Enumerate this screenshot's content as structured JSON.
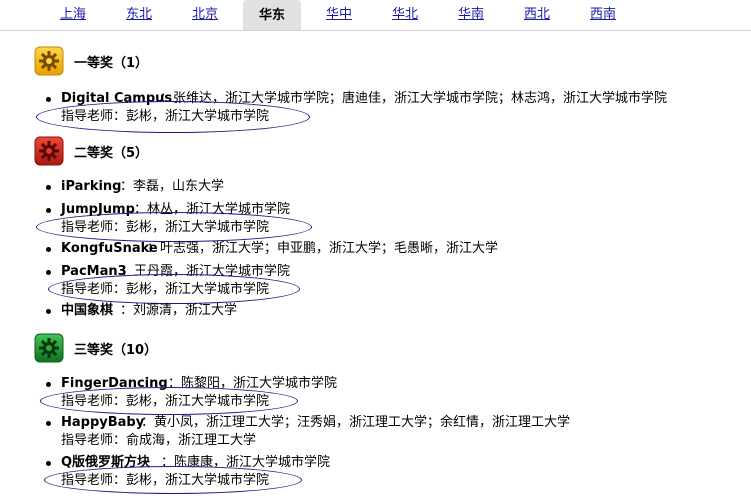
{
  "tabs": [
    {
      "label": "上海",
      "active": false
    },
    {
      "label": "东北",
      "active": false
    },
    {
      "label": "北京",
      "active": false
    },
    {
      "label": "华东",
      "active": true
    },
    {
      "label": "华中",
      "active": false
    },
    {
      "label": "华北",
      "active": false
    },
    {
      "label": "华南",
      "active": false
    },
    {
      "label": "西北",
      "active": false
    },
    {
      "label": "西南",
      "active": false
    }
  ],
  "awards": {
    "first": {
      "title": "一等奖（1）",
      "icon": "gear-icon",
      "color": "#f2b705",
      "entries": [
        {
          "team": "Digital Campus",
          "members": "：张维达，浙江大学城市学院；唐迪佳，浙江大学城市学院；林志鸿，浙江大学城市学院",
          "advisor": "指导老师：彭彬，浙江大学城市学院"
        }
      ]
    },
    "second": {
      "title": "二等奖（5）",
      "icon": "gear-icon",
      "color": "#c8251b",
      "entries": [
        {
          "team": "iParking",
          "members": "：李磊，山东大学"
        },
        {
          "team": "JumpJump",
          "members": "：林丛，浙江大学城市学院",
          "advisor": "指导老师：彭彬，浙江大学城市学院"
        },
        {
          "team": "KongfuSnake",
          "members": "：叶志强，浙江大学；申亚鹏，浙江大学；毛愚晰，浙江大学"
        },
        {
          "team": "PacMan3",
          "members": "：王丹霞，浙江大学城市学院",
          "advisor": "指导老师：彭彬，浙江大学城市学院"
        },
        {
          "team": "中国象棋",
          "members": "：刘源清，浙江大学"
        }
      ]
    },
    "third": {
      "title": "三等奖（10）",
      "icon": "gear-icon",
      "color": "#1e8c2e",
      "entries": [
        {
          "team": "FingerDancing",
          "members": "：陈黎阳，浙江大学城市学院",
          "advisor": "指导老师：彭彬，浙江大学城市学院"
        },
        {
          "team": "HappyBaby",
          "members": "：黄小凤，浙江理工大学；汪秀娟，浙江理工大学；余红情，浙江理工大学",
          "advisor": "指导老师：俞成海，浙江理工大学"
        },
        {
          "team": "Q版俄罗斯方块",
          "members": "：陈康康，浙江大学城市学院",
          "advisor": "指导老师：彭彬，浙江大学城市学院"
        }
      ]
    }
  }
}
